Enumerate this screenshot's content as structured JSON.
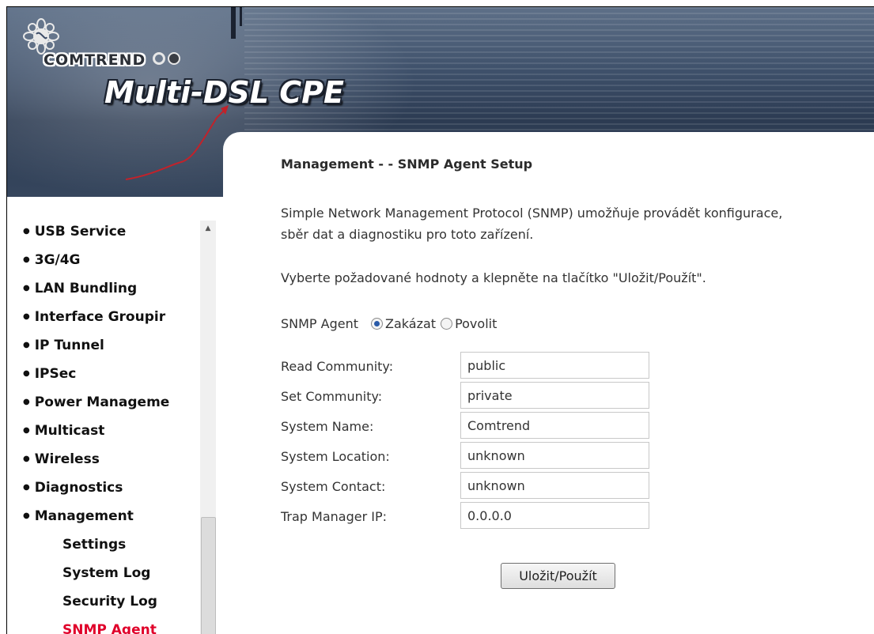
{
  "header": {
    "brand": "COMTREND",
    "product": "Multi-DSL CPE",
    "logo_icon": "comtrend-flower-logo-icon"
  },
  "sidebar": {
    "items": [
      {
        "label": "USB Service",
        "level": 0
      },
      {
        "label": "3G/4G",
        "level": 0
      },
      {
        "label": "LAN Bundling",
        "level": 0
      },
      {
        "label": "Interface Groupir",
        "level": 0
      },
      {
        "label": "IP Tunnel",
        "level": 0
      },
      {
        "label": "IPSec",
        "level": 0
      },
      {
        "label": "Power Manageme",
        "level": 0
      },
      {
        "label": "Multicast",
        "level": 0
      },
      {
        "label": "Wireless",
        "level": 0
      },
      {
        "label": "Diagnostics",
        "level": 0
      },
      {
        "label": "Management",
        "level": 0
      },
      {
        "label": "Settings",
        "level": 1
      },
      {
        "label": "System Log",
        "level": 1
      },
      {
        "label": "Security Log",
        "level": 1
      },
      {
        "label": "SNMP Agent",
        "level": 1,
        "active": true
      }
    ],
    "bullet": "●",
    "scroll_up_glyph": "▲"
  },
  "main": {
    "title": "Management - - SNMP Agent Setup",
    "description": "Simple Network Management Protocol (SNMP) umožňuje provádět konfigurace, sběr dat a diagnostiku pro toto zařízení.",
    "hint": "Vyberte požadované hodnoty a klepněte na tlačítko \"Uložit/Použít\".",
    "agent": {
      "label": "SNMP Agent",
      "options": [
        "Zakázat",
        "Povolit"
      ],
      "selected": "Zakázat"
    },
    "fields": [
      {
        "label": "Read Community:",
        "value": "public"
      },
      {
        "label": "Set Community:",
        "value": "private"
      },
      {
        "label": "System Name:",
        "value": "Comtrend"
      },
      {
        "label": "System Location:",
        "value": "unknown"
      },
      {
        "label": "System Contact:",
        "value": "unknown"
      },
      {
        "label": "Trap Manager IP:",
        "value": "0.0.0.0"
      }
    ],
    "save_label": "Uložit/Použít"
  },
  "colors": {
    "active_menu": "#e0002a",
    "radio_checked": "#2a5aa8"
  }
}
